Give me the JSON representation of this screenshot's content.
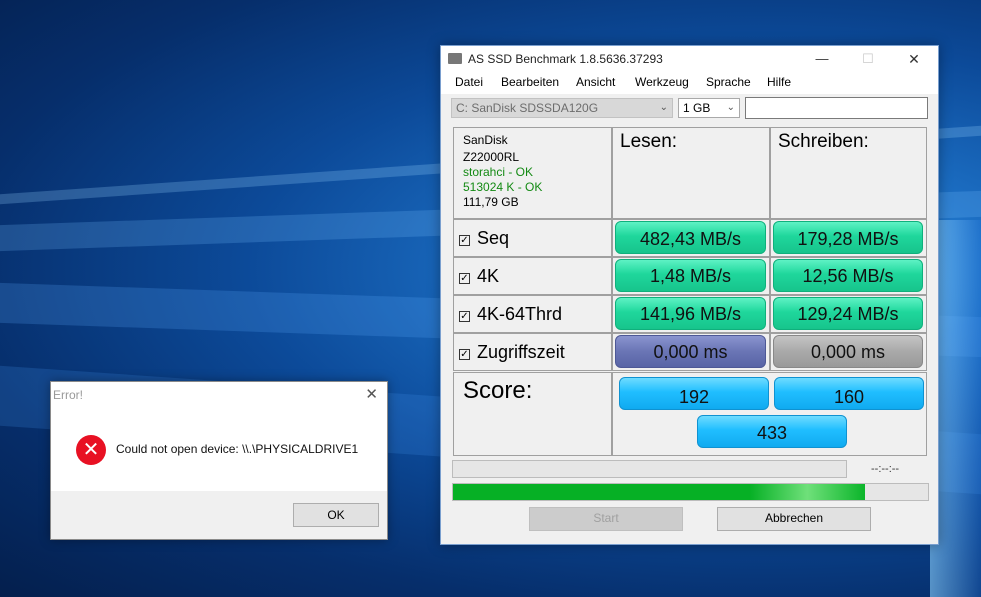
{
  "window": {
    "title": "AS SSD Benchmark 1.8.5636.37293",
    "minimize": "—",
    "maximize": "☐",
    "close": "✕"
  },
  "menu": [
    "Datei",
    "Bearbeiten",
    "Ansicht",
    "Werkzeug",
    "Sprache",
    "Hilfe"
  ],
  "toolbar": {
    "drive": "C: SanDisk SDSSDA120G",
    "size": "1 GB",
    "search_value": ""
  },
  "drive_info": {
    "vendor": "SanDisk",
    "firmware": "Z22000RL",
    "driver": "storahci - OK",
    "alignment": "513024 K - OK",
    "capacity": "111,79 GB"
  },
  "columns": {
    "read": "Lesen:",
    "write": "Schreiben:"
  },
  "tests": [
    {
      "label": "Seq",
      "read": "482,43 MB/s",
      "write": "179,28 MB/s",
      "checked": "☑"
    },
    {
      "label": "4K",
      "read": "1,48 MB/s",
      "write": "12,56 MB/s",
      "checked": "☑"
    },
    {
      "label": "4K-64Thrd",
      "read": "141,96 MB/s",
      "write": "129,24 MB/s",
      "checked": "☑"
    },
    {
      "label": "Zugriffszeit",
      "read": "0,000 ms",
      "write": "0,000 ms",
      "checked": "☑"
    }
  ],
  "score": {
    "label": "Score:",
    "read": "192",
    "write": "160",
    "total": "433"
  },
  "progress": {
    "time": "--:--:--",
    "top_fraction": 0,
    "bottom_fraction": 0.868
  },
  "buttons": {
    "start": "Start",
    "abort": "Abbrechen"
  },
  "error_dialog": {
    "title": "Error!",
    "message": "Could not open device: \\\\.\\PHYSICALDRIVE1",
    "ok": "OK",
    "close": "✕"
  },
  "colors": {
    "green": "#1fd79c",
    "blue": "#20beff",
    "purple": "#6a75b5",
    "gray": "#a9a9a9",
    "progress_green": "#06b025",
    "error_red": "#e81123"
  }
}
